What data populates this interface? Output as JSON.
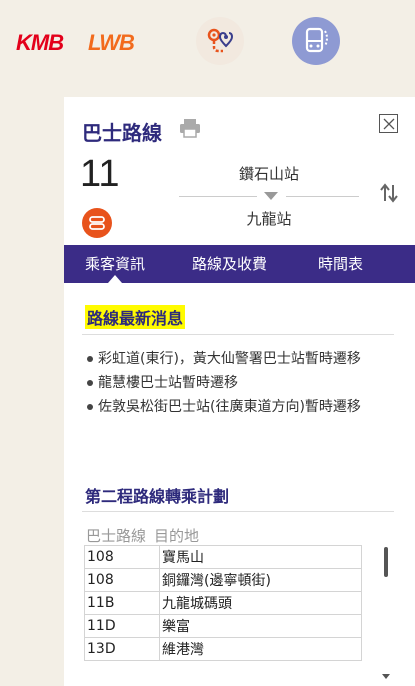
{
  "header": {
    "kmb_logo": "KMB",
    "lwb_logo": "LWB",
    "route_search_icon": "route-pin-icon",
    "bus_icon": "bus-icon"
  },
  "panel": {
    "title": "巴士路線",
    "route_number": "11",
    "origin": "鑽石山站",
    "destination": "九龍站",
    "tabs": [
      "乘客資訊",
      "路線及收費",
      "時間表"
    ],
    "news_heading": "路線最新消息",
    "news": [
      "彩虹道(東行)，黃大仙警署巴士站暫時遷移",
      "龍慧樓巴士站暫時遷移",
      "佐敦吳松街巴士站(往廣東道方向)暫時遷移"
    ],
    "plan_heading": "第二程路線轉乘計劃",
    "table_headers": [
      "巴士路線",
      "目的地"
    ],
    "interchange": [
      {
        "route": "108",
        "dest": "寶馬山"
      },
      {
        "route": "108",
        "dest": "銅鑼灣(邊寧頓街)"
      },
      {
        "route": "11B",
        "dest": "九龍城碼頭"
      },
      {
        "route": "11D",
        "dest": "樂富"
      },
      {
        "route": "13D",
        "dest": "維港灣"
      }
    ]
  },
  "colors": {
    "brand_purple": "#3b2c87",
    "highlight": "#fffb00",
    "kmb_red": "#e3001b",
    "lwb_orange": "#f26b1d"
  }
}
